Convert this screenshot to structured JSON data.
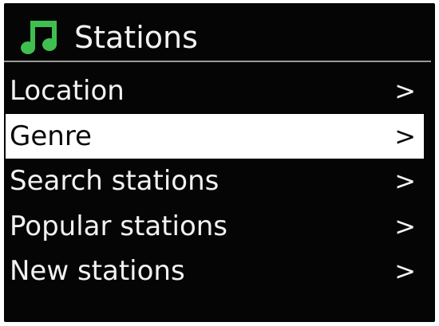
{
  "header": {
    "icon": "music-note-icon",
    "title": "Stations",
    "icon_color": "#3fbf4f"
  },
  "menu": {
    "selected_index": 1,
    "items": [
      {
        "label": "Location",
        "chevron": ">"
      },
      {
        "label": "Genre",
        "chevron": ">"
      },
      {
        "label": "Search stations",
        "chevron": ">"
      },
      {
        "label": "Popular stations",
        "chevron": ">"
      },
      {
        "label": "New stations",
        "chevron": ">"
      }
    ]
  },
  "colors": {
    "background": "#050505",
    "text": "#f2f2f2",
    "highlight_background": "#ffffff",
    "highlight_text": "#0a0a0a"
  }
}
